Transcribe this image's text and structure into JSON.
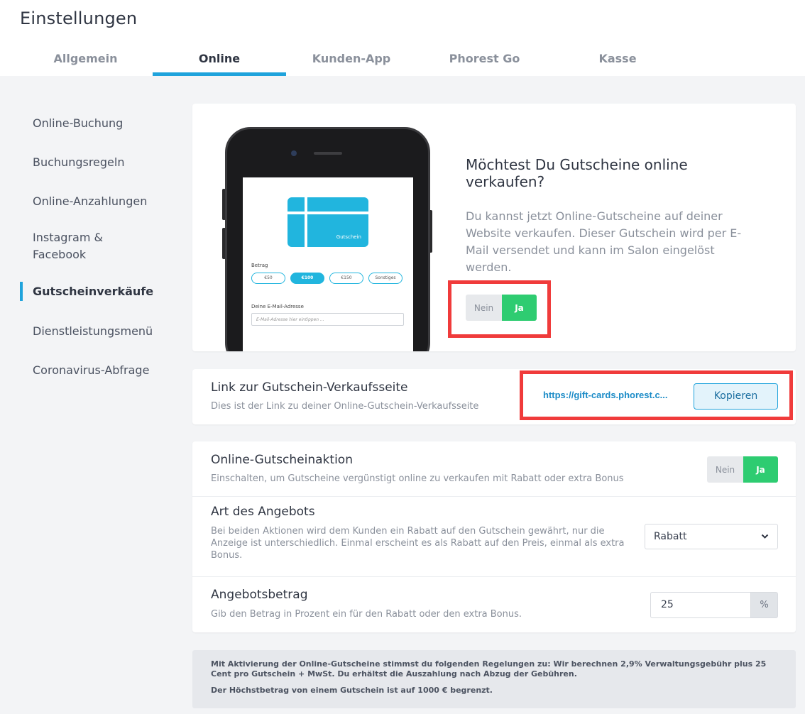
{
  "header": {
    "title": "Einstellungen",
    "tabs": [
      {
        "label": "Allgemein"
      },
      {
        "label": "Online"
      },
      {
        "label": "Kunden-App"
      },
      {
        "label": "Phorest Go"
      },
      {
        "label": "Kasse"
      }
    ],
    "active_tab": "Online"
  },
  "sidebar": {
    "items": [
      {
        "label": "Online-Buchung"
      },
      {
        "label": "Buchungsregeln"
      },
      {
        "label": "Online-Anzahlungen"
      },
      {
        "label": "Instagram &\nFacebook"
      },
      {
        "label": "Gutscheinverkäufe"
      },
      {
        "label": "Dienstleistungsmenü"
      },
      {
        "label": "Coronavirus-Abfrage"
      }
    ],
    "active_item": "Gutscheinverkäufe"
  },
  "promo": {
    "title": "Möchtest Du Gutscheine online verkaufen?",
    "description": "Du kannst jetzt Online-Gutscheine auf deiner Website verkaufen. Dieser Gutschein wird per E-Mail versendet und kann im Salon eingelöst werden.",
    "toggle": {
      "off_label": "Nein",
      "on_label": "Ja",
      "value": "Ja"
    },
    "phone": {
      "voucher_label": "Gutschein",
      "amount_label": "Betrag",
      "amounts": [
        "€50",
        "€100",
        "€150",
        "Sonstiges"
      ],
      "selected_amount": "€100",
      "email_label": "Deine E-Mail-Adresse",
      "email_placeholder": "E-Mail-Adresse hier eintippen ..."
    }
  },
  "link_section": {
    "title": "Link zur Gutschein-Verkaufsseite",
    "description": "Dies ist der Link zu deiner Online-Gutschein-Verkaufsseite",
    "url": "https://gift-cards.phorest.c...",
    "copy_label": "Kopieren"
  },
  "promotion": {
    "title": "Online-Gutscheinaktion",
    "description": "Einschalten, um Gutscheine vergünstigt online zu verkaufen mit Rabatt oder extra Bonus",
    "toggle": {
      "off_label": "Nein",
      "on_label": "Ja",
      "value": "Ja"
    }
  },
  "offer_type": {
    "title": "Art des Angebots",
    "description": "Bei beiden Aktionen wird dem Kunden ein Rabatt auf den Gutschein gewährt, nur die Anzeige ist unterschiedlich. Einmal erscheint es als Rabatt auf den Preis, einmal als extra Bonus.",
    "selected": "Rabatt"
  },
  "offer_amount": {
    "title": "Angebotsbetrag",
    "description": "Gib den Betrag in Prozent ein für den Rabatt oder den extra Bonus.",
    "value": "25",
    "unit": "%"
  },
  "notice": {
    "line1": "Mit Aktivierung der Online-Gutscheine stimmst du folgenden Regelungen zu: Wir berechnen 2,9% Verwaltungsgebühr plus 25 Cent pro Gutschein + MwSt. Du erhältst die Auszahlung nach Abzug der Gebühren.",
    "line2": "Der Höchstbetrag von einem Gutschein ist auf 1000 € begrenzt."
  },
  "colors": {
    "accent": "#1fa3dc",
    "toggle_on": "#2ecc71",
    "highlight": "#f03b3b"
  }
}
